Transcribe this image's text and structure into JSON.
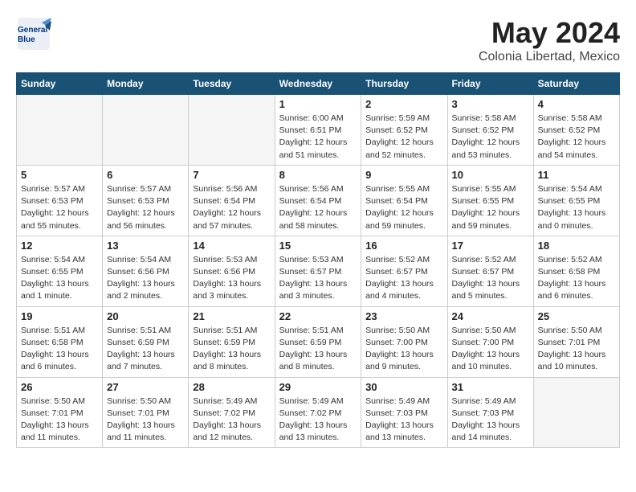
{
  "logo": {
    "line1": "General",
    "line2": "Blue"
  },
  "title": "May 2024",
  "location": "Colonia Libertad, Mexico",
  "weekdays": [
    "Sunday",
    "Monday",
    "Tuesday",
    "Wednesday",
    "Thursday",
    "Friday",
    "Saturday"
  ],
  "weeks": [
    [
      {
        "day": "",
        "info": ""
      },
      {
        "day": "",
        "info": ""
      },
      {
        "day": "",
        "info": ""
      },
      {
        "day": "1",
        "info": "Sunrise: 6:00 AM\nSunset: 6:51 PM\nDaylight: 12 hours\nand 51 minutes."
      },
      {
        "day": "2",
        "info": "Sunrise: 5:59 AM\nSunset: 6:52 PM\nDaylight: 12 hours\nand 52 minutes."
      },
      {
        "day": "3",
        "info": "Sunrise: 5:58 AM\nSunset: 6:52 PM\nDaylight: 12 hours\nand 53 minutes."
      },
      {
        "day": "4",
        "info": "Sunrise: 5:58 AM\nSunset: 6:52 PM\nDaylight: 12 hours\nand 54 minutes."
      }
    ],
    [
      {
        "day": "5",
        "info": "Sunrise: 5:57 AM\nSunset: 6:53 PM\nDaylight: 12 hours\nand 55 minutes."
      },
      {
        "day": "6",
        "info": "Sunrise: 5:57 AM\nSunset: 6:53 PM\nDaylight: 12 hours\nand 56 minutes."
      },
      {
        "day": "7",
        "info": "Sunrise: 5:56 AM\nSunset: 6:54 PM\nDaylight: 12 hours\nand 57 minutes."
      },
      {
        "day": "8",
        "info": "Sunrise: 5:56 AM\nSunset: 6:54 PM\nDaylight: 12 hours\nand 58 minutes."
      },
      {
        "day": "9",
        "info": "Sunrise: 5:55 AM\nSunset: 6:54 PM\nDaylight: 12 hours\nand 59 minutes."
      },
      {
        "day": "10",
        "info": "Sunrise: 5:55 AM\nSunset: 6:55 PM\nDaylight: 12 hours\nand 59 minutes."
      },
      {
        "day": "11",
        "info": "Sunrise: 5:54 AM\nSunset: 6:55 PM\nDaylight: 13 hours\nand 0 minutes."
      }
    ],
    [
      {
        "day": "12",
        "info": "Sunrise: 5:54 AM\nSunset: 6:55 PM\nDaylight: 13 hours\nand 1 minute."
      },
      {
        "day": "13",
        "info": "Sunrise: 5:54 AM\nSunset: 6:56 PM\nDaylight: 13 hours\nand 2 minutes."
      },
      {
        "day": "14",
        "info": "Sunrise: 5:53 AM\nSunset: 6:56 PM\nDaylight: 13 hours\nand 3 minutes."
      },
      {
        "day": "15",
        "info": "Sunrise: 5:53 AM\nSunset: 6:57 PM\nDaylight: 13 hours\nand 3 minutes."
      },
      {
        "day": "16",
        "info": "Sunrise: 5:52 AM\nSunset: 6:57 PM\nDaylight: 13 hours\nand 4 minutes."
      },
      {
        "day": "17",
        "info": "Sunrise: 5:52 AM\nSunset: 6:57 PM\nDaylight: 13 hours\nand 5 minutes."
      },
      {
        "day": "18",
        "info": "Sunrise: 5:52 AM\nSunset: 6:58 PM\nDaylight: 13 hours\nand 6 minutes."
      }
    ],
    [
      {
        "day": "19",
        "info": "Sunrise: 5:51 AM\nSunset: 6:58 PM\nDaylight: 13 hours\nand 6 minutes."
      },
      {
        "day": "20",
        "info": "Sunrise: 5:51 AM\nSunset: 6:59 PM\nDaylight: 13 hours\nand 7 minutes."
      },
      {
        "day": "21",
        "info": "Sunrise: 5:51 AM\nSunset: 6:59 PM\nDaylight: 13 hours\nand 8 minutes."
      },
      {
        "day": "22",
        "info": "Sunrise: 5:51 AM\nSunset: 6:59 PM\nDaylight: 13 hours\nand 8 minutes."
      },
      {
        "day": "23",
        "info": "Sunrise: 5:50 AM\nSunset: 7:00 PM\nDaylight: 13 hours\nand 9 minutes."
      },
      {
        "day": "24",
        "info": "Sunrise: 5:50 AM\nSunset: 7:00 PM\nDaylight: 13 hours\nand 10 minutes."
      },
      {
        "day": "25",
        "info": "Sunrise: 5:50 AM\nSunset: 7:01 PM\nDaylight: 13 hours\nand 10 minutes."
      }
    ],
    [
      {
        "day": "26",
        "info": "Sunrise: 5:50 AM\nSunset: 7:01 PM\nDaylight: 13 hours\nand 11 minutes."
      },
      {
        "day": "27",
        "info": "Sunrise: 5:50 AM\nSunset: 7:01 PM\nDaylight: 13 hours\nand 11 minutes."
      },
      {
        "day": "28",
        "info": "Sunrise: 5:49 AM\nSunset: 7:02 PM\nDaylight: 13 hours\nand 12 minutes."
      },
      {
        "day": "29",
        "info": "Sunrise: 5:49 AM\nSunset: 7:02 PM\nDaylight: 13 hours\nand 13 minutes."
      },
      {
        "day": "30",
        "info": "Sunrise: 5:49 AM\nSunset: 7:03 PM\nDaylight: 13 hours\nand 13 minutes."
      },
      {
        "day": "31",
        "info": "Sunrise: 5:49 AM\nSunset: 7:03 PM\nDaylight: 13 hours\nand 14 minutes."
      },
      {
        "day": "",
        "info": ""
      }
    ]
  ]
}
